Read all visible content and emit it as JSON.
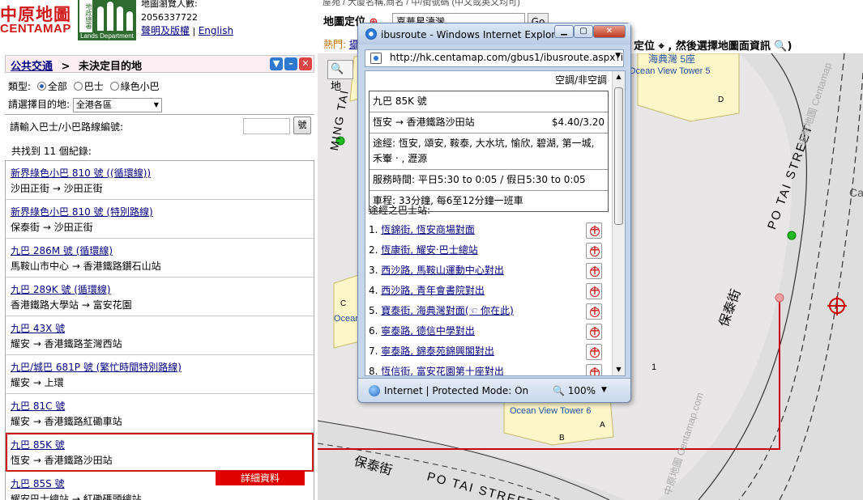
{
  "header": {
    "logo_cn": "中原地圖",
    "logo_en": "CENTAMAP",
    "lands_badge": "地政總署",
    "lands_dept": "Lands Department",
    "visits_label": "地圖瀏覽人數:",
    "visits_count": "2056337722",
    "disclaimer_link": "聲明及版權",
    "english_link": "English"
  },
  "panel": {
    "breadcrumb_link": "公共交通",
    "breadcrumb_sep": ">",
    "breadcrumb_current": "未決定目的地",
    "type_label": "類型:",
    "type_options": [
      "全部",
      "巴士",
      "綠色小巴"
    ],
    "type_selected": "全部",
    "dest_label": "請選擇目的地:",
    "dest_value": "全港各區",
    "route_input_label": "請輸入巴士/小巴路線編號:",
    "route_go_label": "號",
    "found_text": "共找到 11 個紀錄:",
    "detail_button": "詳細資料"
  },
  "routes": [
    {
      "name": "新界綠色小巴 810 號 ((循環線))",
      "path": "沙田正街 → 沙田正街"
    },
    {
      "name": "新界綠色小巴 810 號 (特別路線)",
      "path": "保泰街 → 沙田正街"
    },
    {
      "name": "九巴 286M 號 (循環線)",
      "path": "馬鞍山市中心 → 香港鐵路鑽石山站"
    },
    {
      "name": "九巴 289K 號 (循環線)",
      "path": "香港鐵路大學站 → 富安花園"
    },
    {
      "name": "九巴 43X 號",
      "path": "耀安 → 香港鐵路荃灣西站"
    },
    {
      "name": "九巴/城巴 681P 號 (繁忙時間特別路線)",
      "path": "耀安 → 上環"
    },
    {
      "name": "九巴 81C 號",
      "path": "耀安 → 香港鐵路紅磡車站"
    },
    {
      "name": "九巴 85K 號",
      "path": "恆安 → 香港鐵路沙田站",
      "selected": true
    },
    {
      "name": "九巴 85S 號",
      "path": "耀安巴士總站 → 紅磡碼頭總站"
    }
  ],
  "map": {
    "locate_label": "地圖定位",
    "locate_value": "嘉華星濤灣",
    "go_label": "Go",
    "hot_label": "熱門:",
    "hot_link": "攝",
    "instruction": "定位 ⌖ , 然後選擇地圖面資訊 🔍)",
    "tool_label": "地",
    "address_partial": "屋苑 / 大廈名稱,商名 / 中/街號碼 (中文或英文均可)",
    "labels": {
      "hoi_dim": "海典灣 5座",
      "ocean_view_5": "Ocean View Tower 5",
      "ocean_view_6": "Ocean View Tower 6",
      "ocean_left": "Ocean",
      "ming_tai": "MING TAI",
      "po_tai_street": "PO TAI STREET",
      "po_tai_street_bottom": "PO TAI STREET",
      "po_tai_cn": "保泰街",
      "po_tai_cn_bottom": "保泰街",
      "centamap_watermark": "中原地圖 Centamap",
      "centamap_watermark_bottom": "中原地圖 Centamap.com",
      "edge_ca": "Ca",
      "one": "1",
      "c": "C",
      "d": "D",
      "a": "A",
      "b": "B"
    }
  },
  "popup": {
    "title": "ibusroute - Windows Internet Explorer",
    "url": "http://hk.centamap.com/gbus1/ibusroute.aspx?item",
    "ac_text": "空調/非空調",
    "route": "九巴 85K 號",
    "from_to": "恆安 → 香港鐵路沙田站",
    "fare": "$4.40/3.20",
    "via": "途經: 恆安, 頌安, 鞍泰, 大水坑, 愉欣, 碧湖, 第一城, 禾輋 ‧ , 瀝源",
    "hours": "服務時間: 平日5:30 to 0:05 / 假日5:30 to 0:05",
    "journey": "車程: 33分鐘, 每6至12分鐘一班車",
    "stops_heading": "途經之巴士站:",
    "stops": [
      {
        "num": "1.",
        "name": "恆錦街, 恆安商場對面"
      },
      {
        "num": "2.",
        "name": "恆康街, 耀安‧巴士總站"
      },
      {
        "num": "3.",
        "name": "西沙路, 馬鞍山運動中心對出"
      },
      {
        "num": "4.",
        "name": "西沙路, 青年會書院對出"
      },
      {
        "num": "5.",
        "name": "寶泰街, 海典灣對面",
        "note": "(☜ 你在此)"
      },
      {
        "num": "6.",
        "name": "寧泰路, 德信中學對出"
      },
      {
        "num": "7.",
        "name": "寧泰路, 錦泰苑錦興閣對出"
      },
      {
        "num": "8.",
        "name": "恆信街, 富安花園第十座對出"
      }
    ],
    "status_text": "Internet | Protected Mode: On",
    "zoom": "100%"
  }
}
